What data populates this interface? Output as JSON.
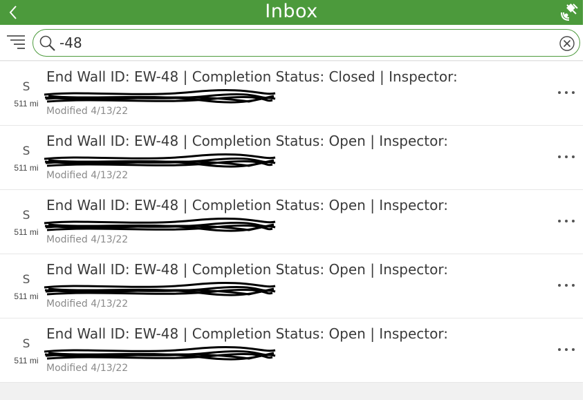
{
  "header": {
    "title": "Inbox"
  },
  "search": {
    "query": "-48"
  },
  "items": [
    {
      "initial": "S",
      "distance": "511 mi",
      "title": "End Wall ID: EW-48 | Completion Status: Closed | Inspector:",
      "modified": "Modified 4/13/22"
    },
    {
      "initial": "S",
      "distance": "511 mi",
      "title": "End Wall ID: EW-48 | Completion Status: Open | Inspector:",
      "modified": "Modified 4/13/22"
    },
    {
      "initial": "S",
      "distance": "511 mi",
      "title": "End Wall ID: EW-48 | Completion Status: Open | Inspector:",
      "modified": "Modified 4/13/22"
    },
    {
      "initial": "S",
      "distance": "511 mi",
      "title": "End Wall ID: EW-48 | Completion Status: Open | Inspector:",
      "modified": "Modified 4/13/22"
    },
    {
      "initial": "S",
      "distance": "511 mi",
      "title": "End Wall ID: EW-48 | Completion Status: Open | Inspector:",
      "modified": "Modified 4/13/22"
    }
  ],
  "colors": {
    "header_green": "#4c9a3c",
    "search_border": "#4c9a3c"
  },
  "icons": {
    "back": "chevron-left-icon",
    "gps": "satellite-signal-icon",
    "filter": "filter-lines-icon",
    "search": "search-icon",
    "clear": "clear-circle-x-icon",
    "more": "more-dots-icon"
  }
}
